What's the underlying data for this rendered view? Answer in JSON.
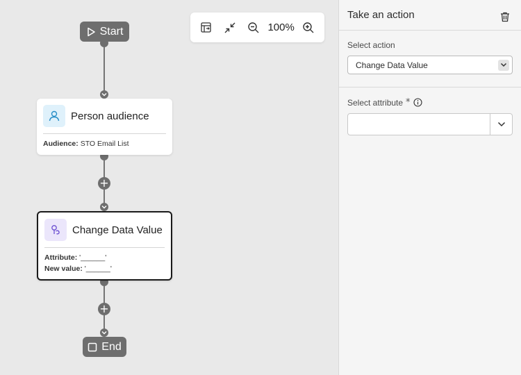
{
  "canvas": {
    "start_label": "Start",
    "end_label": "End",
    "toolbar": {
      "zoom_level": "100%"
    },
    "nodes": [
      {
        "title": "Person audience",
        "details": [
          {
            "key": "Audience:",
            "value": "STO Email List"
          }
        ]
      },
      {
        "title": "Change Data Value",
        "details": [
          {
            "key": "Attribute:",
            "value": "'______'"
          },
          {
            "key": "New value:",
            "value": "'______'"
          }
        ]
      }
    ],
    "plus_symbol": "+"
  },
  "panel": {
    "title": "Take an action",
    "select_action_label": "Select action",
    "select_action_value": "Change Data Value",
    "select_attribute_label": "Select attribute",
    "required_marker": "*",
    "attribute_value": ""
  },
  "colors": {
    "canvas_bg": "#e9e9e9",
    "connector": "#6e6e6e",
    "audience_icon_bg": "#dff1fb",
    "audience_icon": "#2a8fc7",
    "action_icon_bg": "#ebe6fb",
    "action_icon": "#6b4fd1"
  }
}
